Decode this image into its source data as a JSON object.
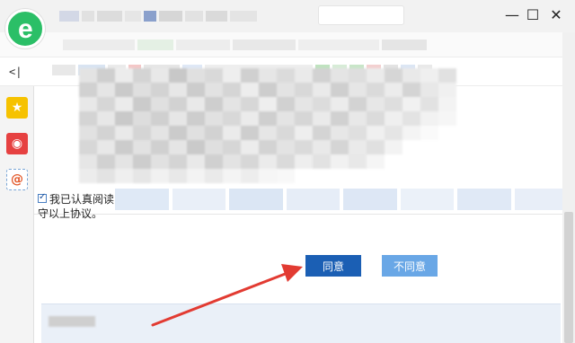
{
  "window": {
    "logo_glyph": "e",
    "minimize_glyph": "—",
    "maximize_glyph": "☐",
    "close_glyph": "✕"
  },
  "toolbar": {
    "collapse_glyph": "<|"
  },
  "sidebar": {
    "items": [
      {
        "icon": "star-icon",
        "glyph": "★"
      },
      {
        "icon": "weibo-icon",
        "glyph": "◉"
      },
      {
        "icon": "email-icon",
        "glyph": "@"
      }
    ]
  },
  "agreement": {
    "checkbox_label": "我已认真阅读守以上协议。",
    "checked": true
  },
  "buttons": {
    "agree_label": "同意",
    "disagree_label": "不同意"
  },
  "colors": {
    "agree": "#1b5fb4",
    "disagree": "#69a7e6",
    "arrow": "#e23b32",
    "logo": "#2bbf67"
  }
}
